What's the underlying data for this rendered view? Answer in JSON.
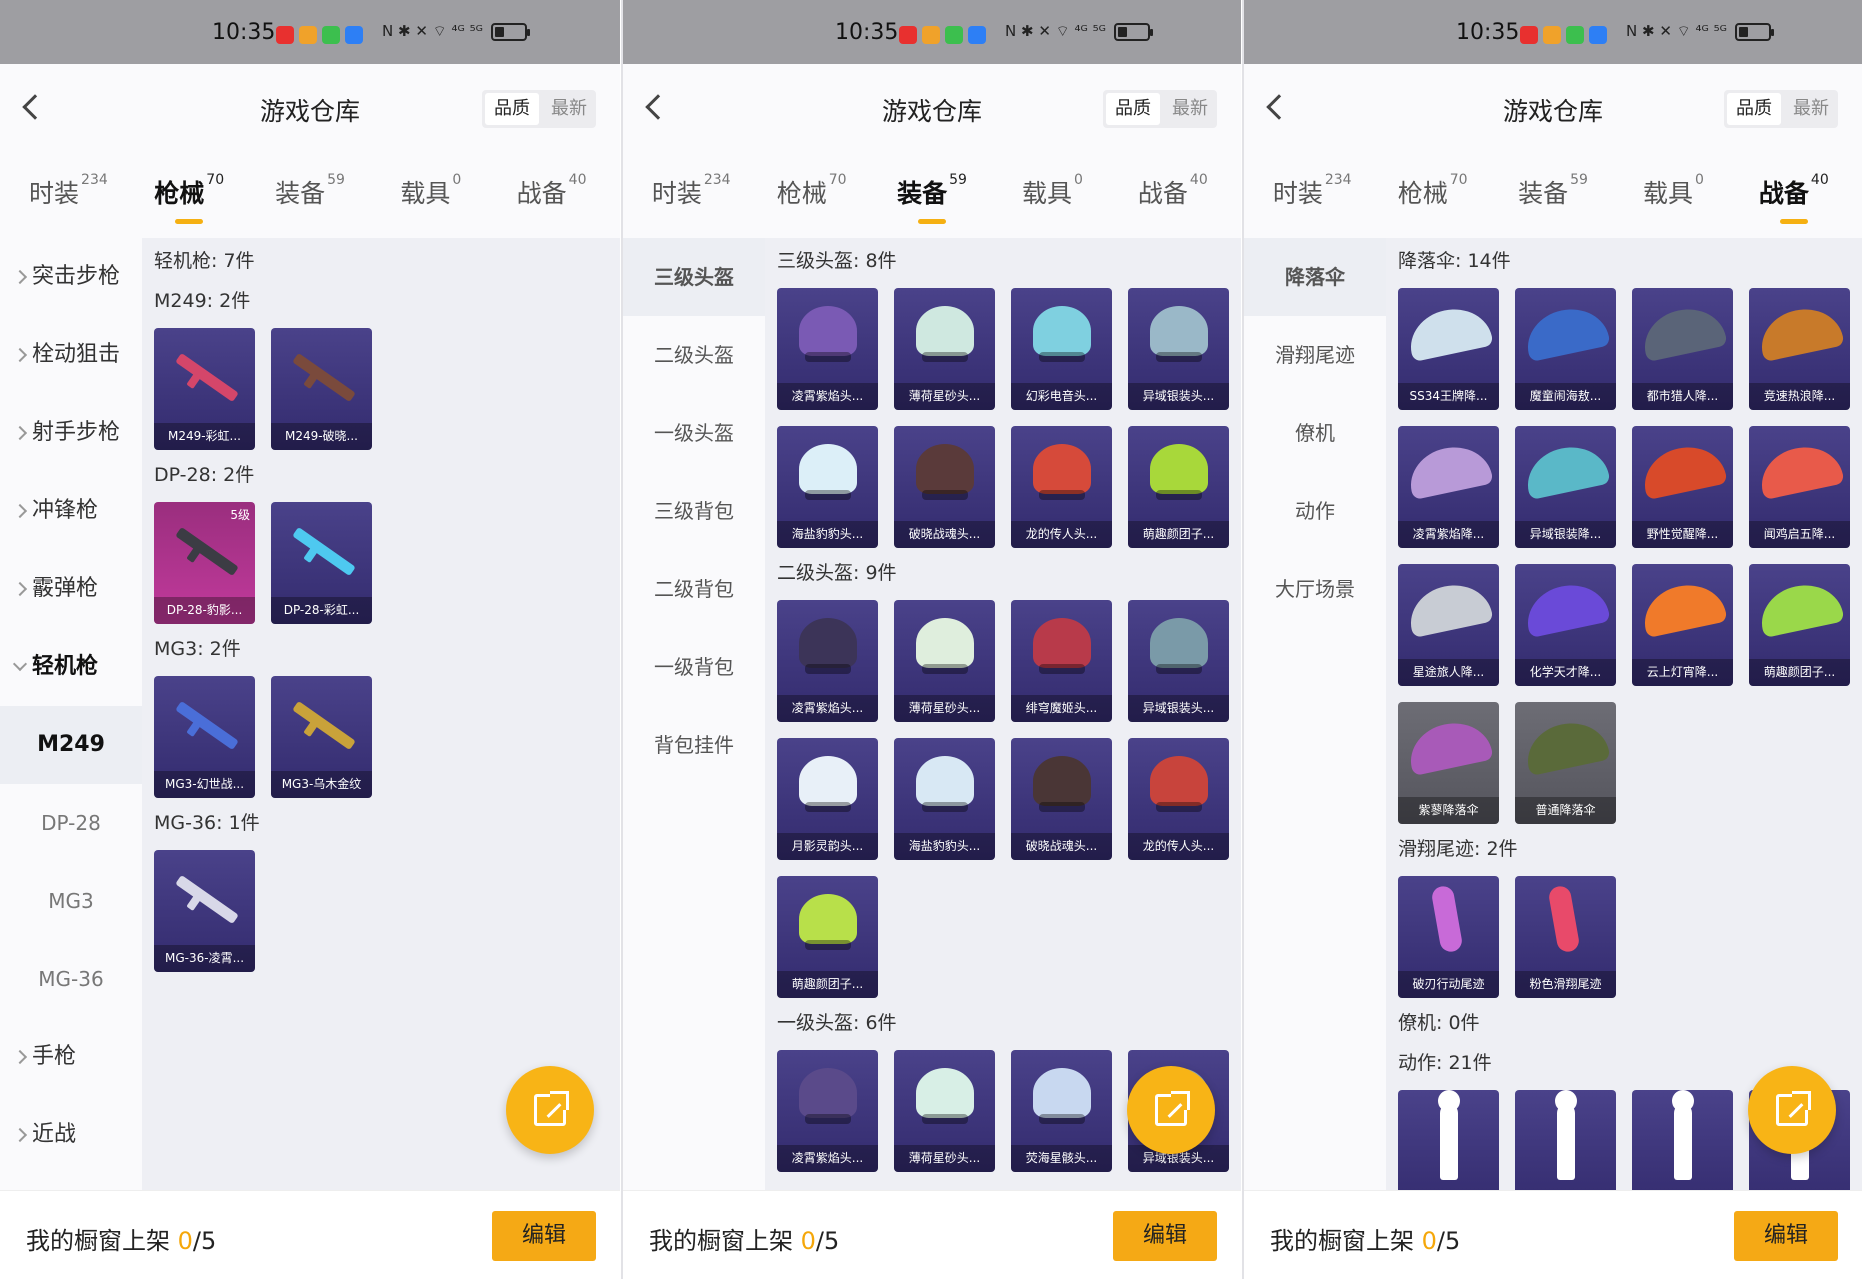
{
  "status": {
    "time": "10:35",
    "sys_icons": "N ✱ ✕ ⌔ ⁴ᴳ ⁵ᴳ",
    "app_colors": [
      "#e8302f",
      "#f0a22a",
      "#3cbf4e",
      "#2d7ff5"
    ]
  },
  "header": {
    "title": "游戏仓库",
    "sort_quality": "品质",
    "sort_latest": "最新"
  },
  "tabs": [
    {
      "label": "时装",
      "count": "234"
    },
    {
      "label": "枪械",
      "count": "70"
    },
    {
      "label": "装备",
      "count": "59"
    },
    {
      "label": "载具",
      "count": "0"
    },
    {
      "label": "战备",
      "count": "40"
    }
  ],
  "footer": {
    "label": "我的橱窗上架",
    "count": "0",
    "total": "/5",
    "edit_label": "编辑"
  },
  "screen1": {
    "sidebar": {
      "groups": [
        "突击步枪",
        "栓动狙击",
        "射手步枪",
        "冲锋枪",
        "霰弹枪"
      ],
      "open_group": "轻机枪",
      "sub": [
        "M249",
        "DP-28",
        "MG3",
        "MG-36"
      ],
      "after": [
        "手枪",
        "近战"
      ]
    },
    "category_header": "轻机枪: 7件",
    "sections": [
      {
        "title": "M249: 2件",
        "items": [
          {
            "name": "M249-彩虹...",
            "color": "#d4466a"
          },
          {
            "name": "M249-破晓...",
            "color": "#7a4a3c"
          }
        ]
      },
      {
        "title": "DP-28: 2件",
        "items": [
          {
            "name": "DP-28-豹影...",
            "badge": "5级",
            "color": "#3c3c44"
          },
          {
            "name": "DP-28-彩虹...",
            "color": "#4ec9f0"
          }
        ]
      },
      {
        "title": "MG3: 2件",
        "items": [
          {
            "name": "MG3-幻世战...",
            "color": "#4a6ed8"
          },
          {
            "name": "MG3-乌木金纹",
            "color": "#c9a23a"
          }
        ]
      },
      {
        "title": "MG-36: 1件",
        "items": [
          {
            "name": "MG-36-凌霄...",
            "color": "#d8d8e8"
          }
        ]
      }
    ]
  },
  "screen2": {
    "sidebar": [
      "三级头盔",
      "二级头盔",
      "一级头盔",
      "三级背包",
      "二级背包",
      "一级背包",
      "背包挂件"
    ],
    "sections": [
      {
        "title": "三级头盔: 8件",
        "items": [
          {
            "name": "凌霄紫焰头...",
            "color": "#7a5ab4"
          },
          {
            "name": "薄荷星砂头...",
            "color": "#cfe8e0"
          },
          {
            "name": "幻彩电音头...",
            "color": "#7fd0e0"
          },
          {
            "name": "异域银装头...",
            "color": "#9ab8c8"
          },
          {
            "name": "海盐豹豹头...",
            "color": "#dceff8"
          },
          {
            "name": "破晓战魂头...",
            "color": "#5a3a3a"
          },
          {
            "name": "龙的传人头...",
            "color": "#d64a3a"
          },
          {
            "name": "萌趣颜团子...",
            "color": "#a8d83a"
          }
        ]
      },
      {
        "title": "二级头盔: 9件",
        "items": [
          {
            "name": "凌霄紫焰头...",
            "color": "#3c3458"
          },
          {
            "name": "薄荷星砂头...",
            "color": "#dfeedd"
          },
          {
            "name": "绯穹魔姬头...",
            "color": "#b83a4a"
          },
          {
            "name": "异域银装头...",
            "color": "#7a9aa8"
          },
          {
            "name": "月影灵韵头...",
            "color": "#e8f0f8"
          },
          {
            "name": "海盐豹豹头...",
            "color": "#d8e8f4"
          },
          {
            "name": "破晓战魂头...",
            "color": "#4a3636"
          },
          {
            "name": "龙的传人头...",
            "color": "#c8443c"
          },
          {
            "name": "萌趣颜团子...",
            "color": "#b8e04a"
          }
        ]
      },
      {
        "title": "一级头盔: 6件",
        "items": [
          {
            "name": "凌霄紫焰头...",
            "color": "#5a4a8a"
          },
          {
            "name": "薄荷星砂头...",
            "color": "#d8efe6"
          },
          {
            "name": "荧海星骸头...",
            "color": "#c8d8f0"
          },
          {
            "name": "异域银装头...",
            "color": "#8aa8b8"
          }
        ]
      }
    ]
  },
  "screen3": {
    "sidebar": [
      "降落伞",
      "滑翔尾迹",
      "僚机",
      "动作",
      "大厅场景"
    ],
    "sections": [
      {
        "title": "降落伞: 14件",
        "items": [
          {
            "name": "SS34王牌降...",
            "color": "#cfe0ec"
          },
          {
            "name": "魔童闹海敖...",
            "color": "#3a6ac8"
          },
          {
            "name": "都市猎人降...",
            "color": "#5a6478"
          },
          {
            "name": "竞速热浪降...",
            "color": "#c87a2a"
          },
          {
            "name": "凌霄紫焰降...",
            "color": "#b89ad8"
          },
          {
            "name": "异域银装降...",
            "color": "#5ab8c8"
          },
          {
            "name": "野性觉醒降...",
            "color": "#d84a2a"
          },
          {
            "name": "闻鸡启五降...",
            "color": "#e85a4a"
          },
          {
            "name": "星途旅人降...",
            "color": "#c8ccd4"
          },
          {
            "name": "化学天才降...",
            "color": "#6a4ad8"
          },
          {
            "name": "云上灯宵降...",
            "color": "#f07a2a"
          },
          {
            "name": "萌趣颜团子...",
            "color": "#9ad84a"
          },
          {
            "name": "紫蓼降落伞",
            "color": "#a85ab8",
            "gray": true
          },
          {
            "name": "普通降落伞",
            "color": "#5a6a3a",
            "gray": true
          }
        ]
      },
      {
        "title": "滑翔尾迹: 2件",
        "items": [
          {
            "name": "破刃行动尾迹",
            "color": "#c86ad8"
          },
          {
            "name": "粉色滑翔尾迹",
            "color": "#e84a6a"
          }
        ]
      },
      {
        "title": "僚机: 0件",
        "items": []
      },
      {
        "title": "动作: 21件",
        "items": [
          {
            "name": "",
            "color": "#ffffff"
          },
          {
            "name": "",
            "color": "#ffffff"
          },
          {
            "name": "",
            "color": "#ffffff"
          },
          {
            "name": "",
            "color": "#ffffff"
          }
        ]
      }
    ]
  }
}
